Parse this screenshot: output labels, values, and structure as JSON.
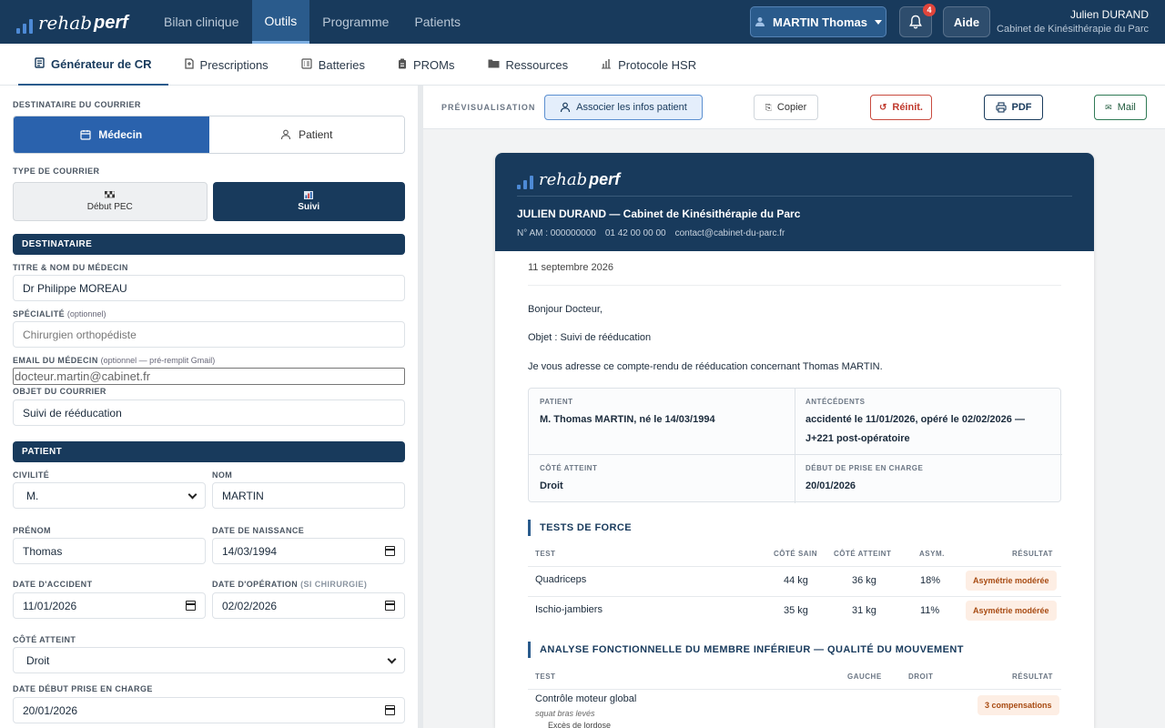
{
  "brand": {
    "part1": "rehab",
    "part2": "perf",
    "accent": "#4d8ad6"
  },
  "nav": {
    "items": [
      {
        "label": "Bilan clinique"
      },
      {
        "label": "Outils"
      },
      {
        "label": "Programme"
      },
      {
        "label": "Patients"
      }
    ],
    "active": "Outils"
  },
  "patient_selector": {
    "label": "MARTIN Thomas"
  },
  "notifications": {
    "count": "4"
  },
  "help": {
    "label": "Aide"
  },
  "user": {
    "name": "Julien DURAND",
    "cabinet": "Cabinet de Kinésithérapie du Parc"
  },
  "subnav": {
    "items": [
      {
        "label": "Générateur de CR",
        "icon": "document-icon"
      },
      {
        "label": "Prescriptions",
        "icon": "prescription-icon"
      },
      {
        "label": "Batteries",
        "icon": "checklist-icon"
      },
      {
        "label": "PROMs",
        "icon": "clipboard-icon"
      },
      {
        "label": "Ressources",
        "icon": "folder-icon"
      },
      {
        "label": "Protocole HSR",
        "icon": "chart-icon"
      }
    ]
  },
  "form": {
    "recipient_label": "DESTINATAIRE DU COURRIER",
    "recipient_options": [
      "Médecin",
      "Patient"
    ],
    "type_label": "TYPE DE COURRIER",
    "type_options": [
      "Début PEC",
      "Suivi"
    ],
    "section_recipient": "DESTINATAIRE",
    "doctor_name_label": "TITRE & NOM DU MÉDECIN",
    "doctor_name": "Dr Philippe MOREAU",
    "specialty_label": "SPÉCIALITÉ",
    "specialty_hint": "(optionnel)",
    "specialty_placeholder": "Chirurgien orthopédiste",
    "email_label": "EMAIL DU MÉDECIN",
    "email_hint": "(optionnel — pré-remplit Gmail)",
    "email_placeholder": "docteur.martin@cabinet.fr",
    "subject_label": "OBJET DU COURRIER",
    "subject": "Suivi de rééducation",
    "section_patient": "PATIENT",
    "civility_label": "CIVILITÉ",
    "civility": "M.",
    "lastname_label": "NOM",
    "lastname": "MARTIN",
    "firstname_label": "PRÉNOM",
    "firstname": "Thomas",
    "birth_label": "DATE DE NAISSANCE",
    "birth": "14/03/1994",
    "accident_label": "DATE D'ACCIDENT",
    "accident": "11/01/2026",
    "operation_label": "DATE D'OPÉRATION",
    "operation_hint": "(SI CHIRURGIE)",
    "operation": "02/02/2026",
    "side_label": "CÔTÉ ATTEINT",
    "side": "Droit",
    "start_label": "DATE DÉBUT PRISE EN CHARGE",
    "start": "20/01/2026"
  },
  "preview": {
    "label": "PRÉVISUALISATION",
    "associate_btn": "Associer les infos patient",
    "copy_btn": "Copier",
    "reset_btn": "Réinit.",
    "pdf_btn": "PDF",
    "mail_btn": "Mail",
    "header_title": "JULIEN DURAND — Cabinet de Kinésithérapie du Parc",
    "am": "N° AM : 000000000",
    "phone": "01 42 00 00 00",
    "email": "contact@cabinet-du-parc.fr",
    "date": "11 septembre 2026",
    "greeting": "Bonjour Docteur,",
    "subject_line": "Objet : Suivi de rééducation",
    "intro": "Je vous adresse ce compte-rendu de rééducation concernant Thomas MARTIN.",
    "info": {
      "patient_label": "PATIENT",
      "patient": "M. Thomas MARTIN, né le 14/03/1994",
      "history_label": "ANTÉCÉDENTS",
      "history_line1": "accidenté le 11/01/2026, opéré le 02/02/2026 —",
      "history_line2": "J+221 post-opératoire",
      "side_label": "CÔTÉ ATTEINT",
      "side": "Droit",
      "start_label": "DÉBUT DE PRISE EN CHARGE",
      "start": "20/01/2026"
    },
    "strength": {
      "title": "TESTS DE FORCE",
      "headers": [
        "TEST",
        "CÔTÉ SAIN",
        "CÔTÉ ATTEINT",
        "ASYM.",
        "RÉSULTAT"
      ],
      "rows": [
        {
          "test": "Quadriceps",
          "healthy": "44 kg",
          "affected": "36 kg",
          "asym": "18%",
          "result": "Asymétrie modérée"
        },
        {
          "test": "Ischio-jambiers",
          "healthy": "35 kg",
          "affected": "31 kg",
          "asym": "11%",
          "result": "Asymétrie modérée"
        }
      ]
    },
    "functional": {
      "title": "ANALYSE FONCTIONNELLE DU MEMBRE INFÉRIEUR — QUALITÉ DU MOUVEMENT",
      "headers": [
        "TEST",
        "GAUCHE",
        "DROIT",
        "RÉSULTAT"
      ],
      "row": {
        "test": "Contrôle moteur global",
        "sub": "squat bras levés",
        "detail": "Excès de lordose",
        "result": "3 compensations"
      }
    }
  }
}
